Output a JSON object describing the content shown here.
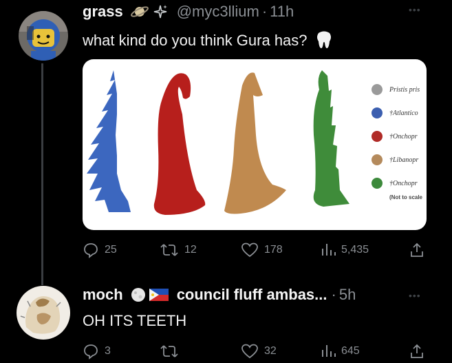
{
  "tweets": [
    {
      "author_name": "grass",
      "author_emojis": "🪐 ✨",
      "handle": "@myc3llium",
      "separator": "·",
      "time": "11h",
      "text": "what kind do you think Gura has?",
      "text_emoji": "🦷",
      "media": {
        "legend": [
          {
            "label": "Pristis pris",
            "color": "#9a9a9a"
          },
          {
            "label": "†Atlantico",
            "color": "#3c5fb0"
          },
          {
            "label": "†Onchopr",
            "color": "#b02b27"
          },
          {
            "label": "†Libanopr",
            "color": "#b48a5c"
          },
          {
            "label": "†Onchopr",
            "color": "#3d8a3c"
          }
        ],
        "note": "(Not to scale",
        "teeth_colors": [
          "#3c67bf",
          "#b71f1c",
          "#c08a4f",
          "#3f8c3a"
        ]
      },
      "actions": {
        "replies": "25",
        "retweets": "12",
        "likes": "178",
        "views": "5,435"
      }
    },
    {
      "author_name": "moch",
      "display_suffix": "council fluff ambas...",
      "separator": "·",
      "time": "5h",
      "text": "OH ITS TEETH",
      "actions": {
        "replies": "3",
        "retweets": "",
        "likes": "32",
        "views": "645"
      }
    }
  ],
  "colors": {
    "background": "#000000",
    "text_primary": "#e7e9ea",
    "text_secondary": "#8b8f94",
    "thread_line": "#3a3d41"
  },
  "icons": {
    "reply": "reply-icon",
    "retweet": "retweet-icon",
    "like": "heart-icon",
    "views": "views-icon",
    "share": "share-icon",
    "more": "more-icon"
  }
}
